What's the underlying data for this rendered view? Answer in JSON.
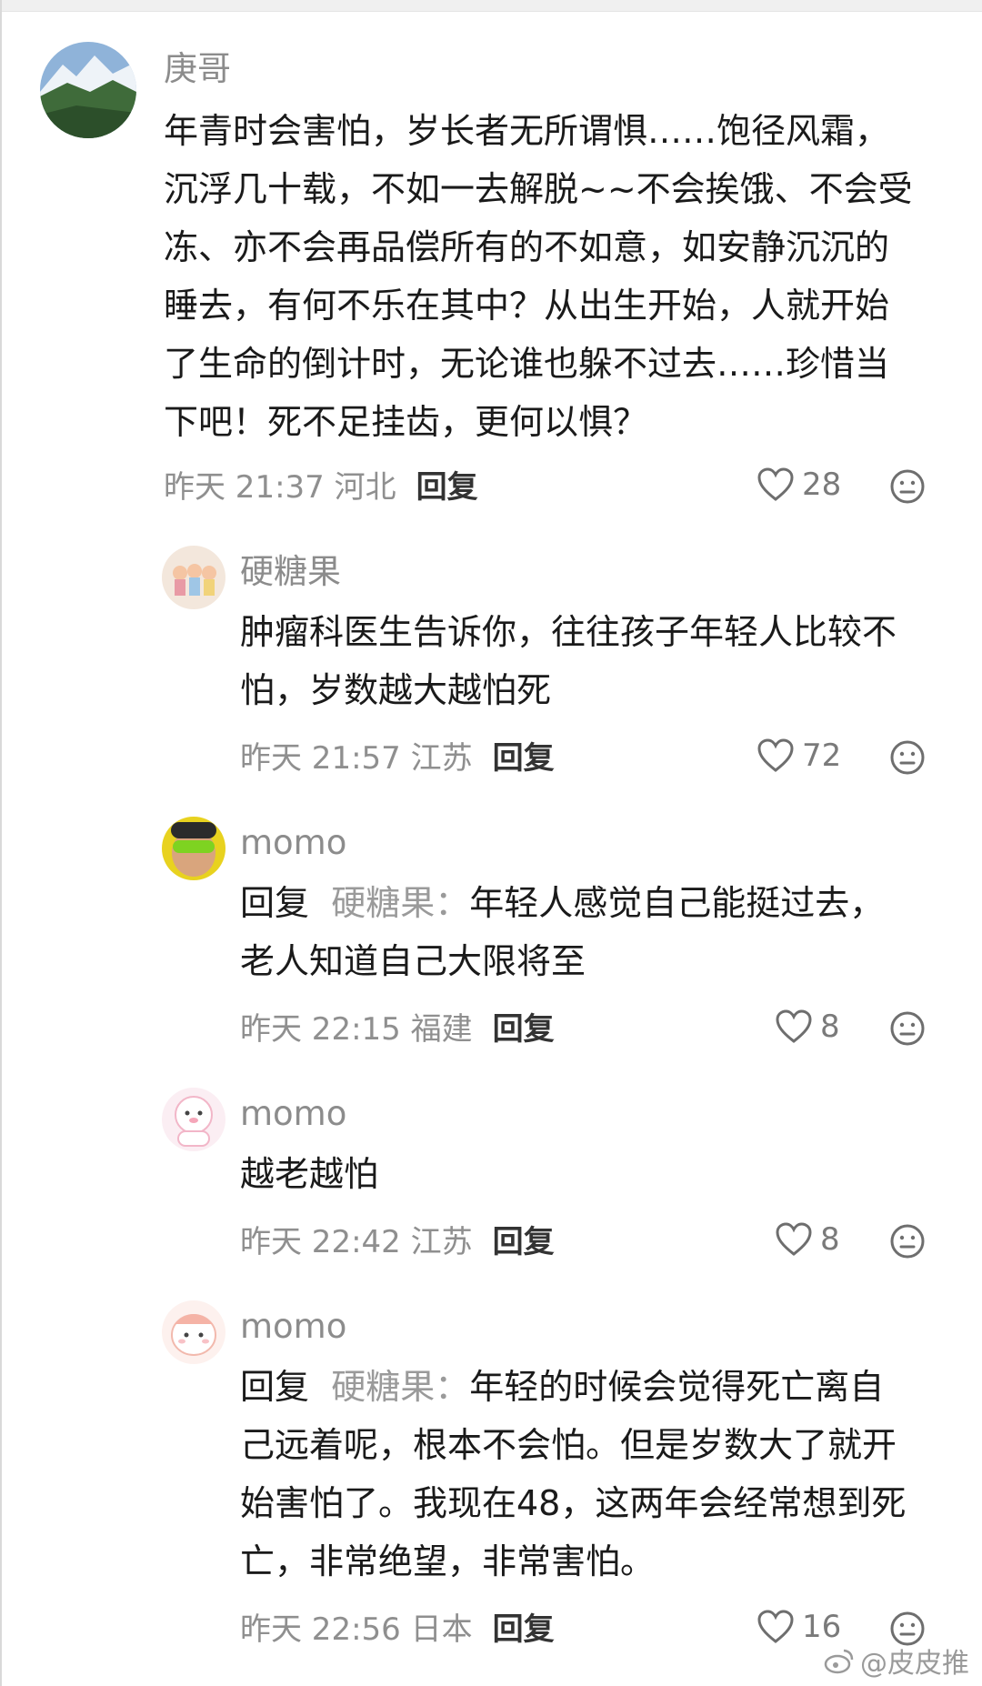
{
  "comments": [
    {
      "author": "庚哥",
      "lines": [
        "年青时会害怕，岁长者无所谓惧……饱径风霜，",
        "沉浮几十载，不如一去解脱~~不会挨饿、不会受",
        "冻、亦不会再品偿所有的不如意，如安静沉沉的",
        "睡去，有何不乐在其中？从出生开始，人就开始",
        "了生命的倒计时，无论谁也躲不过去……珍惜当",
        "下吧！死不足挂齿，更何以惧？"
      ],
      "time": "昨天 21:37 河北",
      "reply_label": "回复",
      "likes": "28"
    },
    {
      "author": "硬糖果",
      "lines": [
        "肿瘤科医生告诉你，往往孩子年轻人比较不",
        "怕，岁数越大越怕死"
      ],
      "time": "昨天 21:57 江苏",
      "reply_label": "回复",
      "likes": "72"
    },
    {
      "author": "momo",
      "reply_prefix": "回复",
      "reply_target": "硬糖果：",
      "lines": [
        "年轻人感觉自己能挺过去，",
        "老人知道自己大限将至"
      ],
      "time": "昨天 22:15 福建",
      "reply_label": "回复",
      "likes": "8"
    },
    {
      "author": "momo",
      "lines": [
        "越老越怕"
      ],
      "time": "昨天 22:42 江苏",
      "reply_label": "回复",
      "likes": "8"
    },
    {
      "author": "momo",
      "reply_prefix": "回复",
      "reply_target": "硬糖果：",
      "lines": [
        "年轻的时候会觉得死亡离自",
        "己远着呢，根本不会怕。但是岁数大了就开",
        "始害怕了。我现在48，这两年会经常想到死",
        "亡，非常绝望，非常害怕。"
      ],
      "time": "昨天 22:56 日本",
      "reply_label": "回复",
      "likes": "16"
    }
  ],
  "watermark": "@皮皮推"
}
